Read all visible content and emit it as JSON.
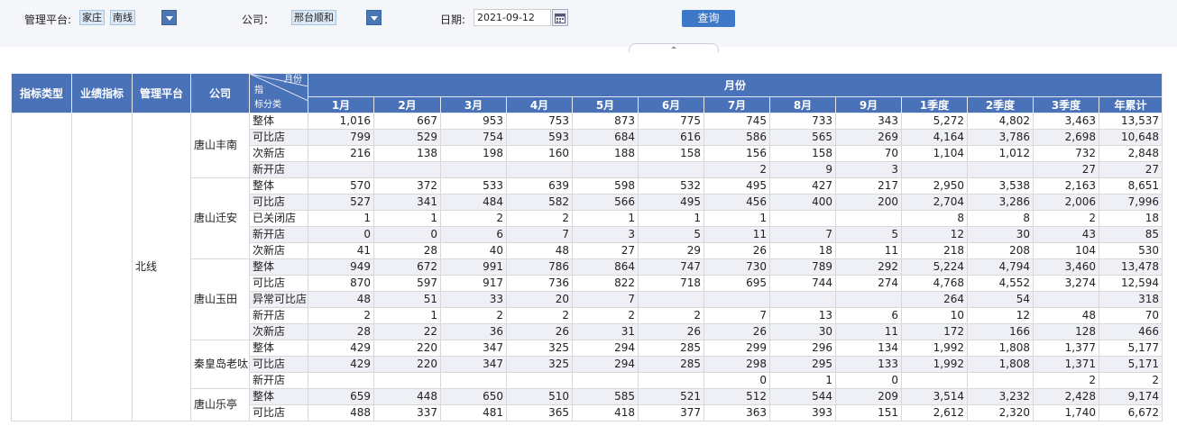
{
  "filters": {
    "platform_label": "管理平台:",
    "platform_tags": [
      "家庄",
      "南线"
    ],
    "company_label": "公司：",
    "company_tag": "邢台顺和",
    "date_label": "日期:",
    "date_value": "2021-09-12",
    "query_label": "查询"
  },
  "header": {
    "col_indicator_type": "指标类型",
    "col_metric": "业绩指标",
    "col_platform": "管理平台",
    "col_company": "公司",
    "diag_top": "月份",
    "diag_mid": "指",
    "diag_bottom": "标分类",
    "group_label": "月份",
    "months": [
      "1月",
      "2月",
      "3月",
      "4月",
      "5月",
      "6月",
      "7月",
      "8月",
      "9月",
      "1季度",
      "2季度",
      "3季度",
      "年累计"
    ]
  },
  "table": {
    "platform_value": "北线",
    "companies": [
      {
        "name": "唐山丰南",
        "rows": [
          {
            "cat": "整体",
            "v": [
              "1,016",
              "667",
              "953",
              "753",
              "873",
              "775",
              "745",
              "733",
              "343",
              "5,272",
              "4,802",
              "3,463",
              "13,537"
            ]
          },
          {
            "cat": "可比店",
            "v": [
              "799",
              "529",
              "754",
              "593",
              "684",
              "616",
              "586",
              "565",
              "269",
              "4,164",
              "3,786",
              "2,698",
              "10,648"
            ]
          },
          {
            "cat": "次新店",
            "v": [
              "216",
              "138",
              "198",
              "160",
              "188",
              "158",
              "156",
              "158",
              "70",
              "1,104",
              "1,012",
              "732",
              "2,848"
            ]
          },
          {
            "cat": "新开店",
            "v": [
              "",
              "",
              "",
              "",
              "",
              "",
              "2",
              "9",
              "3",
              "",
              "",
              "27",
              "27"
            ]
          }
        ]
      },
      {
        "name": "唐山迁安",
        "rows": [
          {
            "cat": "整体",
            "v": [
              "570",
              "372",
              "533",
              "639",
              "598",
              "532",
              "495",
              "427",
              "217",
              "2,950",
              "3,538",
              "2,163",
              "8,651"
            ]
          },
          {
            "cat": "可比店",
            "v": [
              "527",
              "341",
              "484",
              "582",
              "566",
              "495",
              "456",
              "400",
              "200",
              "2,704",
              "3,286",
              "2,006",
              "7,996"
            ]
          },
          {
            "cat": "已关闭店",
            "v": [
              "1",
              "1",
              "2",
              "2",
              "1",
              "1",
              "1",
              "",
              "",
              "8",
              "8",
              "2",
              "18"
            ]
          },
          {
            "cat": "新开店",
            "v": [
              "0",
              "0",
              "6",
              "7",
              "3",
              "5",
              "11",
              "7",
              "5",
              "12",
              "30",
              "43",
              "85"
            ]
          },
          {
            "cat": "次新店",
            "v": [
              "41",
              "28",
              "40",
              "48",
              "27",
              "29",
              "26",
              "18",
              "11",
              "218",
              "208",
              "104",
              "530"
            ]
          }
        ]
      },
      {
        "name": "唐山玉田",
        "rows": [
          {
            "cat": "整体",
            "v": [
              "949",
              "672",
              "991",
              "786",
              "864",
              "747",
              "730",
              "789",
              "292",
              "5,224",
              "4,794",
              "3,460",
              "13,478"
            ]
          },
          {
            "cat": "可比店",
            "v": [
              "870",
              "597",
              "917",
              "736",
              "822",
              "718",
              "695",
              "744",
              "274",
              "4,768",
              "4,552",
              "3,274",
              "12,594"
            ]
          },
          {
            "cat": "异常可比店",
            "v": [
              "48",
              "51",
              "33",
              "20",
              "7",
              "",
              "",
              "",
              "",
              "264",
              "54",
              "",
              "318"
            ]
          },
          {
            "cat": "新开店",
            "v": [
              "2",
              "1",
              "2",
              "2",
              "2",
              "2",
              "7",
              "13",
              "6",
              "10",
              "12",
              "48",
              "70"
            ]
          },
          {
            "cat": "次新店",
            "v": [
              "28",
              "22",
              "36",
              "26",
              "31",
              "26",
              "26",
              "30",
              "11",
              "172",
              "166",
              "128",
              "466"
            ]
          }
        ]
      },
      {
        "name": "秦皇岛老呔",
        "rows": [
          {
            "cat": "整体",
            "v": [
              "429",
              "220",
              "347",
              "325",
              "294",
              "285",
              "299",
              "296",
              "134",
              "1,992",
              "1,808",
              "1,377",
              "5,177"
            ]
          },
          {
            "cat": "可比店",
            "v": [
              "429",
              "220",
              "347",
              "325",
              "294",
              "285",
              "298",
              "295",
              "133",
              "1,992",
              "1,808",
              "1,371",
              "5,171"
            ]
          },
          {
            "cat": "新开店",
            "v": [
              "",
              "",
              "",
              "",
              "",
              "",
              "0",
              "1",
              "0",
              "",
              "",
              "2",
              "2"
            ]
          }
        ]
      },
      {
        "name": "唐山乐亭",
        "rows": [
          {
            "cat": "整体",
            "v": [
              "659",
              "448",
              "650",
              "510",
              "585",
              "521",
              "512",
              "544",
              "209",
              "3,514",
              "3,232",
              "2,428",
              "9,174"
            ]
          },
          {
            "cat": "可比店",
            "v": [
              "488",
              "337",
              "481",
              "365",
              "418",
              "377",
              "363",
              "393",
              "151",
              "2,612",
              "2,320",
              "1,740",
              "6,672"
            ]
          }
        ]
      }
    ]
  }
}
